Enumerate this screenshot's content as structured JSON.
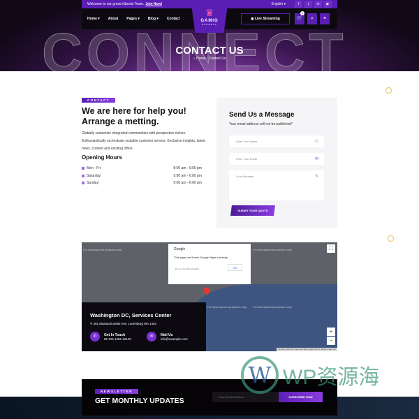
{
  "topbar": {
    "welcome": "Welcome to our great eSports Team.",
    "join": "Join Now!",
    "language": "English ▾",
    "social": [
      "f",
      "t",
      "in",
      "▶"
    ]
  },
  "nav": {
    "items": [
      "Home ▾",
      "About",
      "Pages ▾",
      "Blog ▾",
      "Contact"
    ],
    "live": "Live Streaming",
    "cart_count": "0"
  },
  "logo": {
    "name": "GAMIO",
    "sub": "ESPORTS"
  },
  "hero": {
    "bg_word": "CONNECT",
    "title": "CONTACT US",
    "breadcrumb": "⌂ Home / Contact Us"
  },
  "contact": {
    "tag": "CONTACT",
    "heading": "We are here for help you! Arrange a metting.",
    "description": "Globally customize integrated communities with prospective niches. Enthusiastically orchestrate scalable customer service. Exclusive insights, latest news, content and exciting offers.",
    "hours_title": "Opening Hours",
    "hours": [
      {
        "day": "Mon - Fri:",
        "time": "8:00 am - 5:00 pm"
      },
      {
        "day": "Saturday:",
        "time": "9:00 am - 6:00 pm"
      },
      {
        "day": "Sunday:",
        "time": "9:00 am - 6:00 pm"
      }
    ]
  },
  "form": {
    "title": "Send Us a Message",
    "subtitle": "Your email address will not be published*",
    "name_ph": "Enter Your Name",
    "email_ph": "Enter Your Email",
    "message_ph": "Your Message",
    "submit": "SUBMIT YOUR QUOTE"
  },
  "map": {
    "dev_text": "For development purposes only",
    "popup_title": "Google",
    "popup_msg": "This page can't load Google Maps correctly.",
    "popup_q": "Do you own this website?",
    "popup_ok": "OK",
    "attribution": "Keyboard shortcuts | Map data ©2024 Google | Terms | Report a map error"
  },
  "location": {
    "title": "Washington DC, Services Center",
    "address": "301 Massachusetts Ave, Lunenburg MA 1462",
    "phone_label": "Get In Touch",
    "phone": "85 125 1256 12145",
    "mail_label": "Mail Us",
    "mail": "info@example.com"
  },
  "newsletter": {
    "tag": "NEWSLETTER",
    "title": "GET MONTHLY UPDATES",
    "email_ph": "Enter Email Address",
    "subscribe": "SUBSCRIBE NOW"
  },
  "watermark": "WP资源海",
  "colors": {
    "accent": "#5b1eb4",
    "dark": "#0c0a10"
  }
}
